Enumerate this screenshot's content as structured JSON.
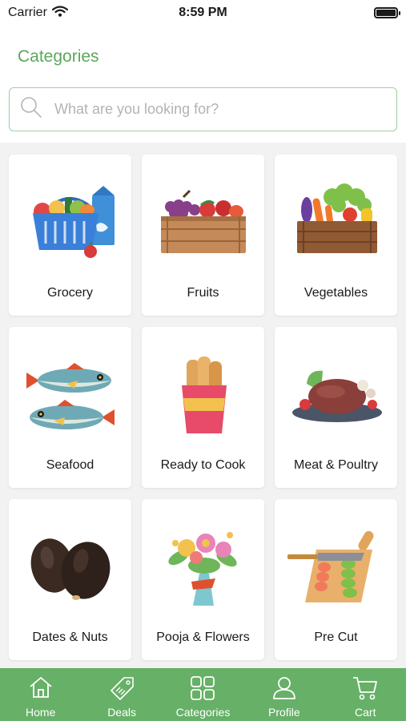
{
  "status_bar": {
    "carrier": "Carrier",
    "time": "8:59 PM"
  },
  "header": {
    "title": "Categories"
  },
  "search": {
    "placeholder": "What are you looking for?"
  },
  "categories": [
    {
      "label": "Grocery",
      "icon": "grocery-basket-icon"
    },
    {
      "label": "Fruits",
      "icon": "fruit-crate-icon"
    },
    {
      "label": "Vegetables",
      "icon": "vegetable-crate-icon"
    },
    {
      "label": "Seafood",
      "icon": "fish-icon"
    },
    {
      "label": "Ready to Cook",
      "icon": "fries-box-icon"
    },
    {
      "label": "Meat & Poultry",
      "icon": "roast-chicken-icon"
    },
    {
      "label": "Dates & Nuts",
      "icon": "dates-icon"
    },
    {
      "label": "Pooja & Flowers",
      "icon": "flower-bouquet-icon"
    },
    {
      "label": "Pre Cut",
      "icon": "cutting-board-icon"
    }
  ],
  "tabbar": {
    "items": [
      {
        "label": "Home",
        "icon": "home-icon"
      },
      {
        "label": "Deals",
        "icon": "deals-tag-icon"
      },
      {
        "label": "Categories",
        "icon": "grid-icon"
      },
      {
        "label": "Profile",
        "icon": "profile-icon"
      },
      {
        "label": "Cart",
        "icon": "cart-icon"
      }
    ]
  },
  "colors": {
    "brand_green": "#5aa85a",
    "tabbar_green": "#67b067",
    "search_border": "#9fcf9f",
    "background": "#f2f2f2"
  }
}
